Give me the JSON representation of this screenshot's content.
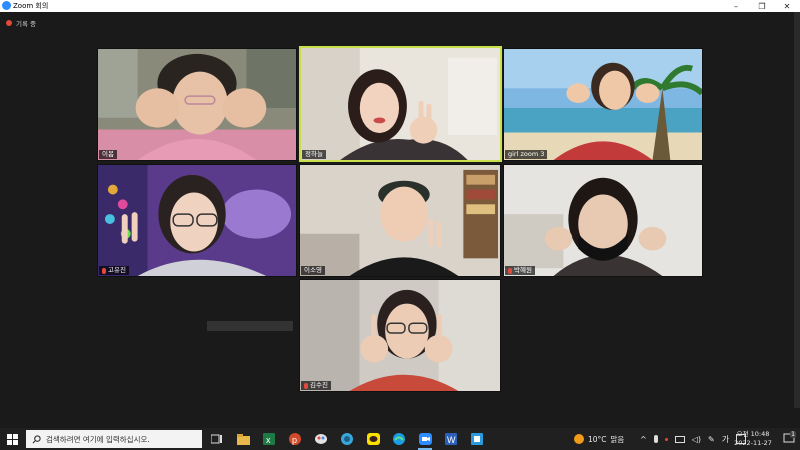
{
  "window": {
    "title": "Zoom 회의",
    "min_glyph": "–",
    "max_glyph": "❐",
    "close_glyph": "✕"
  },
  "recording": {
    "label": "기록 중"
  },
  "participants": [
    {
      "name": "이봄"
    },
    {
      "name": "정하늘"
    },
    {
      "name": "girl zoom 3"
    },
    {
      "name": "고유진"
    },
    {
      "name": "이소영"
    },
    {
      "name": "박혜원"
    },
    {
      "name": "김수진"
    }
  ],
  "taskbar": {
    "search_placeholder": "검색하려면 여기에 입력하십시오.",
    "weather": {
      "temp": "10°C",
      "condition": "맑음"
    },
    "lang": "가",
    "clock": {
      "time": "오전 10:48",
      "date": "2022-11-27"
    },
    "notification_count": "1",
    "apps": [
      "task-view",
      "file-explorer",
      "excel",
      "powerpoint",
      "paint",
      "edge-app",
      "kakaotalk",
      "edge",
      "zoom",
      "word",
      "calendar-app"
    ]
  }
}
